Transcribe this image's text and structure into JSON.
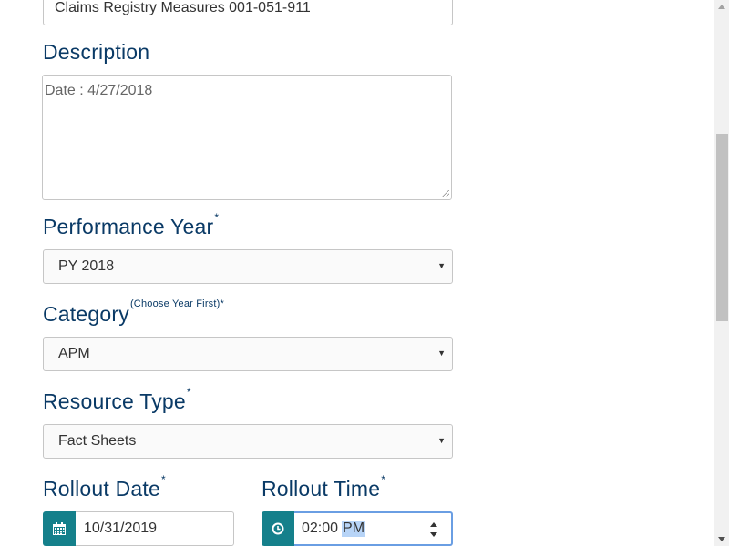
{
  "form": {
    "title_value": "Claims Registry Measures 001-051-911",
    "description": {
      "label": "Description",
      "value": "Date :  4/27/2018"
    },
    "performance_year": {
      "label": "Performance Year",
      "required_mark": "*",
      "selected": "PY 2018"
    },
    "category": {
      "label": "Category",
      "hint": "(Choose Year First)*",
      "selected": "APM"
    },
    "resource_type": {
      "label": "Resource Type",
      "required_mark": "*",
      "selected": "Fact Sheets"
    },
    "rollout_date": {
      "label": "Rollout Date",
      "required_mark": "*",
      "value": "10/31/2019",
      "icon": "calendar-icon"
    },
    "rollout_time": {
      "label": "Rollout Time",
      "required_mark": "*",
      "time_value": "02:00",
      "ampm_value": "PM",
      "icon": "clock-icon"
    },
    "select_arrow_glyph": "▼"
  },
  "colors": {
    "label_text": "#0a3a66",
    "addon_bg": "#15808b",
    "focus_border": "#6a9ee3",
    "selection_bg": "#b7d4f7"
  }
}
